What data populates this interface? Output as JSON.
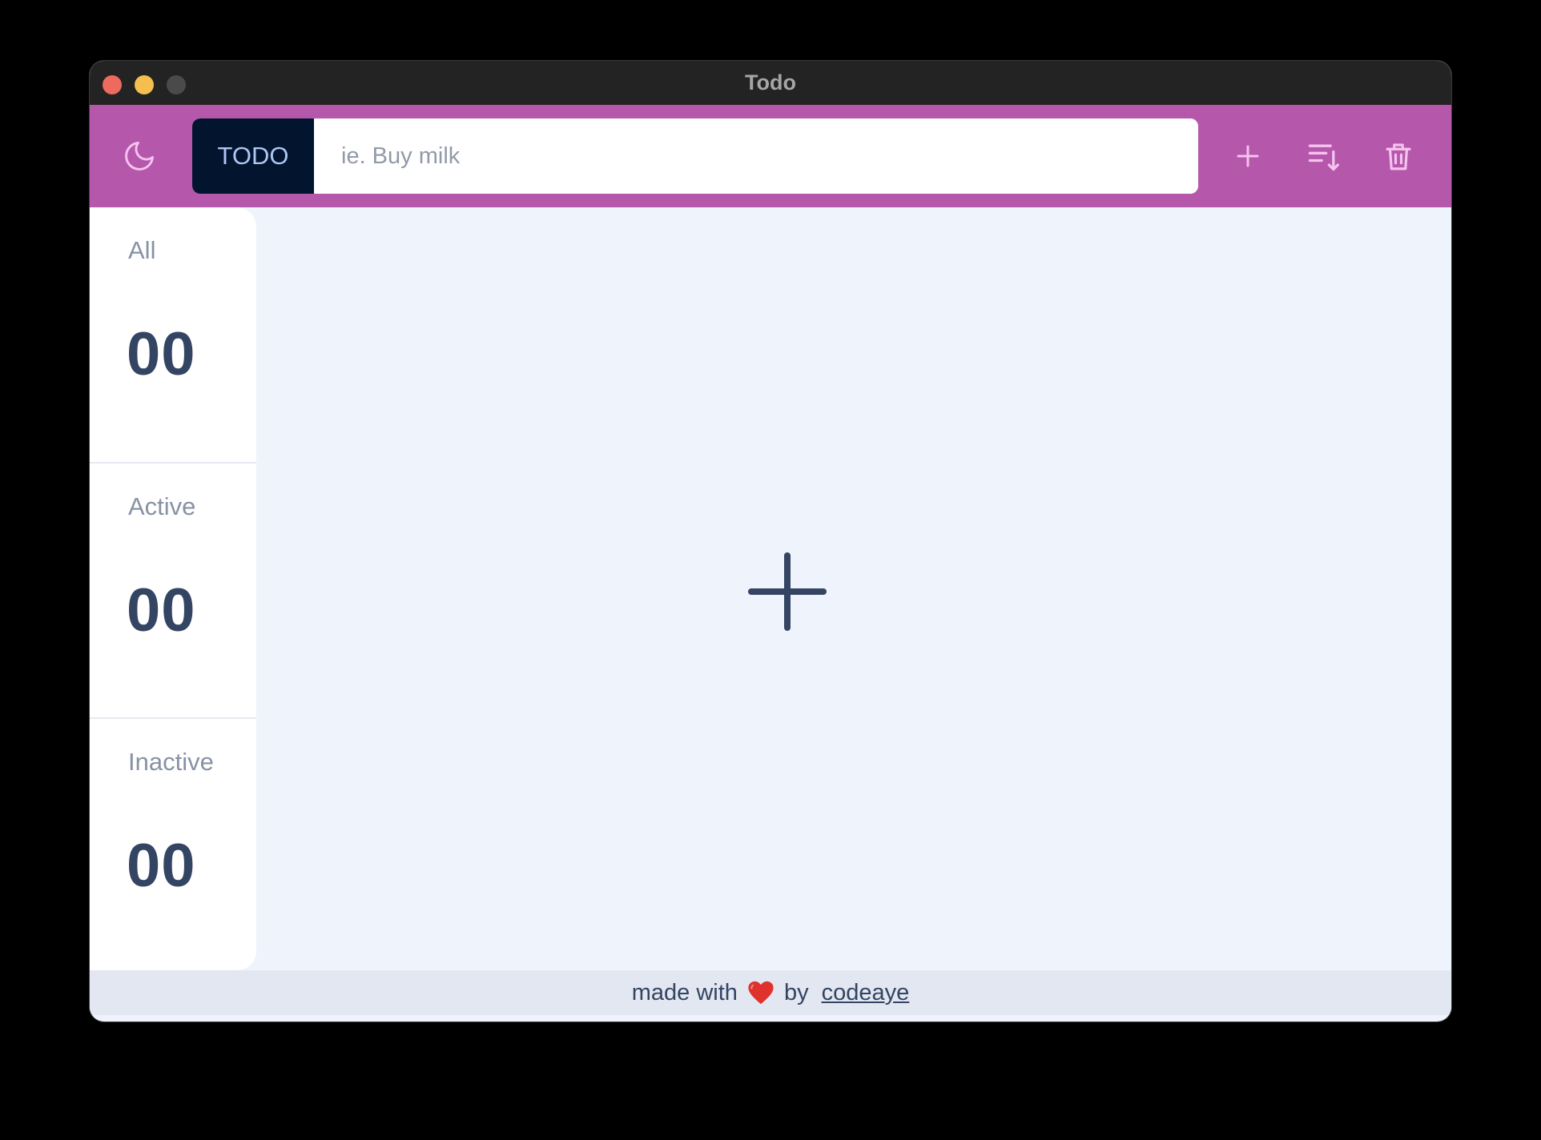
{
  "window": {
    "title": "Todo"
  },
  "header": {
    "tag_label": "TODO",
    "input_placeholder": "ie. Buy milk",
    "input_value": "",
    "icons": {
      "theme": "moon-icon",
      "add": "plus-icon",
      "sort": "sort-icon",
      "delete": "trash-icon"
    },
    "icon_color": "#f6c3ef"
  },
  "sidebar": {
    "items": [
      {
        "label": "All",
        "count": "00"
      },
      {
        "label": "Active",
        "count": "00"
      },
      {
        "label": "Inactive",
        "count": "00"
      }
    ]
  },
  "main": {
    "empty_icon": "plus-icon",
    "empty_icon_color": "#344563"
  },
  "footer": {
    "prefix": "made with",
    "heart_icon": "heart-icon",
    "by": "by",
    "author": "codeaye"
  },
  "colors": {
    "header_bg": "#b557ab",
    "tag_bg": "#03142f",
    "main_bg": "#eff3fb",
    "text_dark": "#344563",
    "muted": "#8792a5"
  }
}
